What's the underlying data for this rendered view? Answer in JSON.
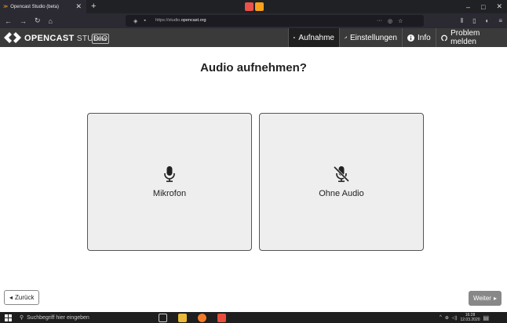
{
  "browser": {
    "tab_title": "Opencast Studio (beta)",
    "tab_close": "✕",
    "new_tab": "+",
    "url_prefix": "https://studio.",
    "url_domain": "opencast.org",
    "url_more": "···",
    "window_controls": [
      "–",
      "□",
      "✕"
    ],
    "accent_orange": "#f9a01b"
  },
  "app": {
    "brand_main": "OPENCAST",
    "brand_sub": "STUDIO",
    "beta": "beta",
    "nav": {
      "record": "Aufnahme",
      "settings": "Einstellungen",
      "info": "Info",
      "problem": "Problem melden"
    },
    "header_bg": "#3a3a3a",
    "active_nav_bg": "#1f1f1f"
  },
  "main": {
    "title": "Audio aufnehmen?",
    "option_mic": "Mikrofon",
    "option_noaudio": "Ohne Audio",
    "icons": [
      "microphone-icon",
      "microphone-off-icon"
    ]
  },
  "footer": {
    "back": "Zurück",
    "next": "Weiter"
  },
  "taskbar": {
    "search_placeholder": "Suchbegriff hier eingeben",
    "time": "16:28",
    "date": "12.03.2020"
  }
}
